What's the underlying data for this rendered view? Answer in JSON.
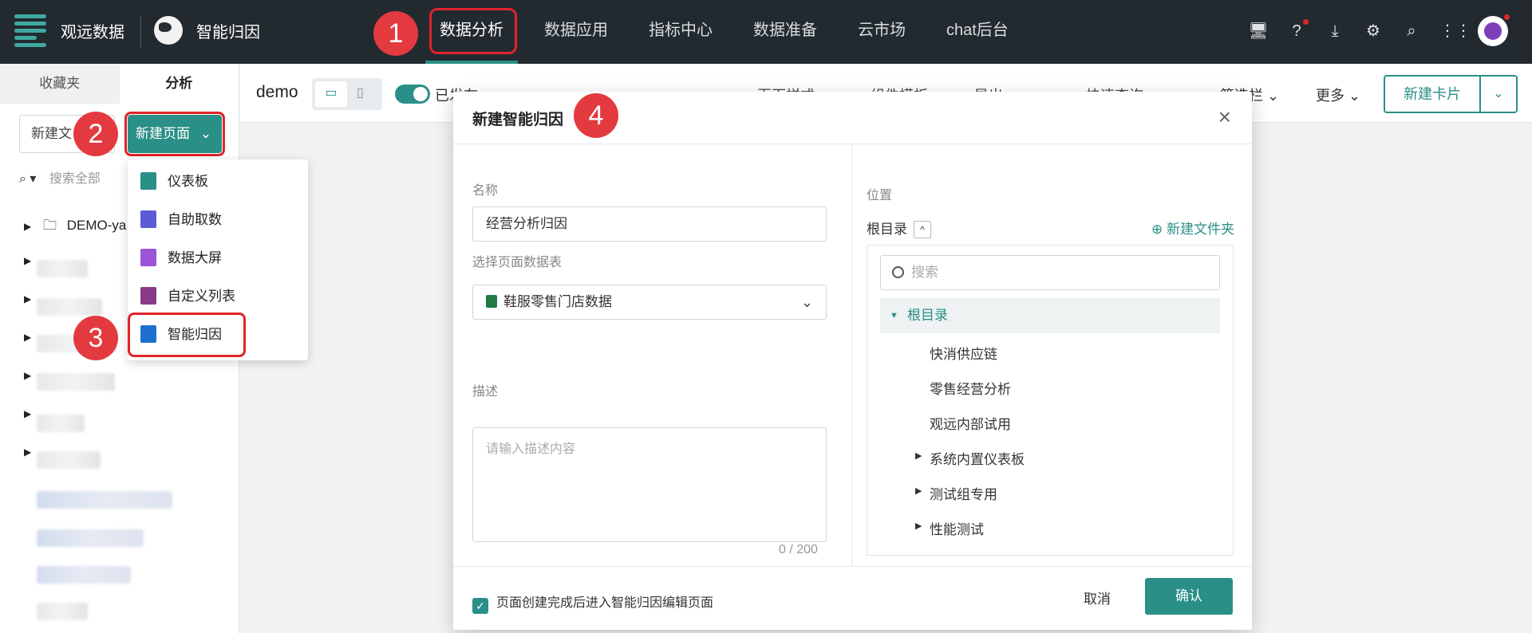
{
  "header": {
    "brand": "观远数据",
    "app_name": "智能归因",
    "nav": [
      "数据分析",
      "数据应用",
      "指标中心",
      "数据准备",
      "云市场",
      "chat后台"
    ],
    "active_nav": "数据分析",
    "icons": [
      "monitor-icon",
      "help-icon",
      "download-icon",
      "settings-icon",
      "search-icon",
      "apps-grid-icon",
      "avatar"
    ]
  },
  "badges": [
    "1",
    "2",
    "3",
    "4"
  ],
  "sidebar": {
    "tabs": [
      "收藏夹",
      "分析"
    ],
    "new_file_label": "新建文",
    "new_page_label": "新建页面",
    "search_placeholder": "搜索全部",
    "tree_first": "DEMO-ya"
  },
  "new_page_menu": {
    "items": [
      {
        "label": "仪表板",
        "icon": "dashboard-icon",
        "color": "#2a8f86"
      },
      {
        "label": "自助取数",
        "icon": "extract-icon",
        "color": "#5b5bd6"
      },
      {
        "label": "数据大屏",
        "icon": "big-screen-icon",
        "color": "#9b55d6"
      },
      {
        "label": "自定义列表",
        "icon": "list-icon",
        "color": "#8a3a8a"
      },
      {
        "label": "智能归因",
        "icon": "attribution-icon",
        "color": "#1f6fd1"
      }
    ]
  },
  "toolbar": {
    "page_name": "demo",
    "published_label": "已发布",
    "faded_items": [
      "页面样式",
      "组件模板",
      "导出",
      "快速查询"
    ],
    "filter_bar": "筛选栏",
    "more": "更多",
    "new_card": "新建卡片"
  },
  "modal": {
    "title": "新建智能归因",
    "name_label": "名称",
    "name_value": "经营分析归因",
    "table_label": "选择页面数据表",
    "table_value": "鞋服零售门店数据",
    "desc_label": "描述",
    "desc_placeholder": "请输入描述内容",
    "desc_counter": "0 / 200",
    "checkbox_label": "页面创建完成后进入智能归因编辑页面",
    "position_label": "位置",
    "root_label": "根目录",
    "new_folder": "新建文件夹",
    "tree_search_placeholder": "搜索",
    "tree_root": "根目录",
    "tree_items": [
      "快消供应链",
      "零售经营分析",
      "观远内部试用",
      "系统内置仪表板",
      "测试组专用",
      "性能测试"
    ],
    "cancel": "取消",
    "confirm": "确认"
  },
  "colors": {
    "accent": "#2a8f86",
    "highlight": "#e0242a",
    "badge": "#e33a3f",
    "topbar": "#222a30"
  }
}
